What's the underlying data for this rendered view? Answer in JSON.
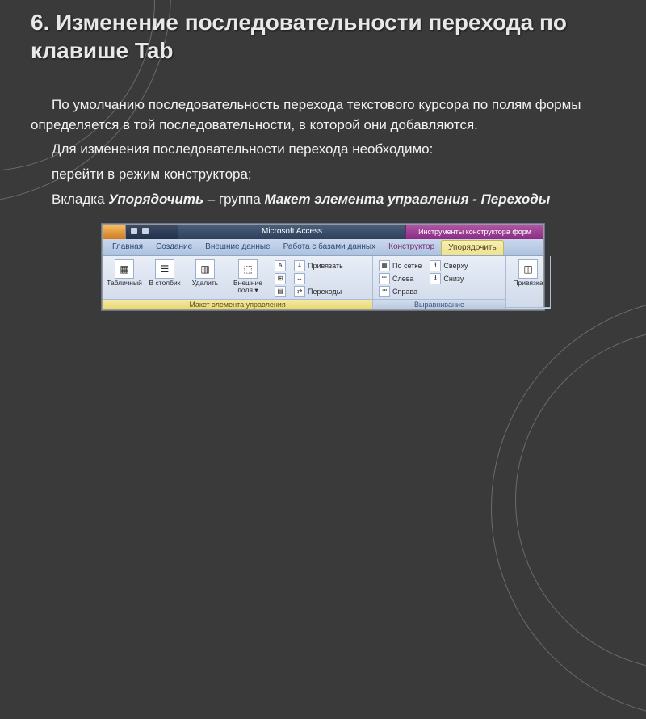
{
  "title": "6. Изменение последовательности перехода по клавише Tab",
  "para1": "По умолчанию последовательность перехода  текстового курсора по полям формы определяется в той последовательности, в которой они добавляются.",
  "para2": "Для изменения последовательности перехода необходимо:",
  "para3": "перейти в режим конструктора;",
  "para4_a": "Вкладка ",
  "para4_b": "Упорядочить",
  "para4_c": " – группа ",
  "para4_d": "Макет элемента управления - Переходы",
  "ribbon": {
    "app_title": "Microsoft Access",
    "context_title": "Инструменты конструктора форм",
    "tabs": {
      "t1": "Главная",
      "t2": "Создание",
      "t3": "Внешние данные",
      "t4": "Работа с базами данных",
      "t5": "Конструктор",
      "t6": "Упорядочить"
    },
    "g_layout": {
      "label": "Макет элемента управления",
      "tabular": "Табличный",
      "columns": "В столбик",
      "remove": "Удалить",
      "margins": "Внешние поля ▾",
      "a_icon": "A",
      "bind": "Привязать",
      "transitions": "Переходы"
    },
    "g_align": {
      "label": "Выравнивание",
      "grid": "По сетке",
      "left": "Слева",
      "right": "Справа",
      "top": "Сверху",
      "bottom": "Снизу"
    },
    "g_anchor": {
      "label": "",
      "anchor": "Привязка"
    }
  }
}
